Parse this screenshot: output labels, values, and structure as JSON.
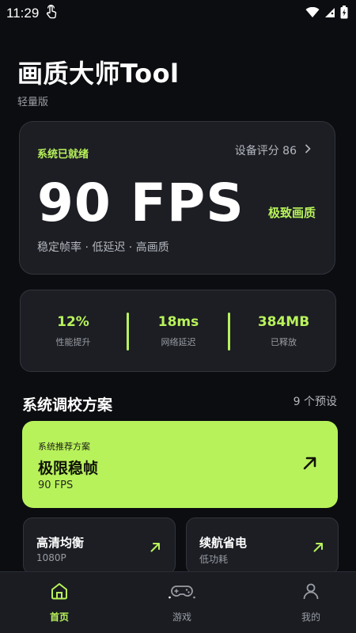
{
  "status_bar": {
    "time": "11:29"
  },
  "header": {
    "title": "画质大师Tool",
    "subtitle": "轻量版"
  },
  "fps_card": {
    "status": "系统已就绪",
    "score_label": "设备评分 86",
    "fps_value": "90 FPS",
    "quality": "极致画质",
    "description": "稳定帧率 · 低延迟 · 高画质"
  },
  "stats": [
    {
      "value": "12%",
      "label": "性能提升"
    },
    {
      "value": "18ms",
      "label": "网络延迟"
    },
    {
      "value": "384MB",
      "label": "已释放"
    }
  ],
  "plans_section": {
    "title": "系统调校方案",
    "count": "9 个预设"
  },
  "recommended_plan": {
    "tag": "系统推荐方案",
    "name": "极限稳帧",
    "fps": "90 FPS"
  },
  "plans": [
    {
      "name": "高清均衡",
      "sub": "1080P"
    },
    {
      "name": "续航省电",
      "sub": "低功耗"
    }
  ],
  "bottom_nav": {
    "items": [
      {
        "label": "首页",
        "icon": "home-icon",
        "active": true
      },
      {
        "label": "游戏",
        "icon": "gamepad-icon",
        "active": false
      },
      {
        "label": "我的",
        "icon": "user-icon",
        "active": false
      }
    ]
  },
  "colors": {
    "accent": "#b8f25b",
    "background": "#0c0d10",
    "card": "#1c1e24"
  }
}
